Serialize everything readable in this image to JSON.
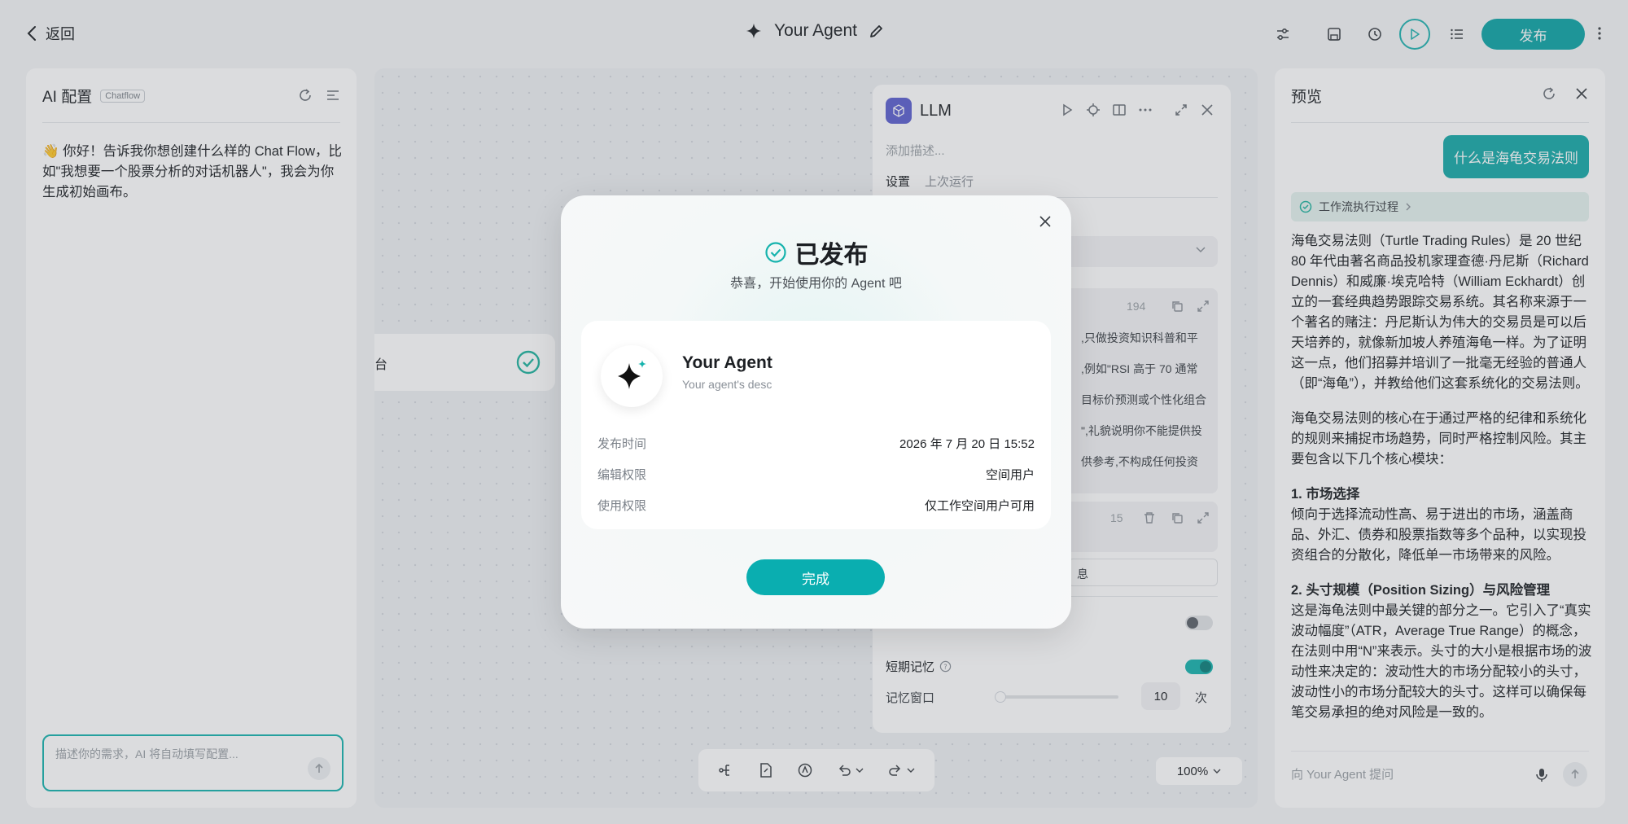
{
  "topbar": {
    "back_label": "返回",
    "agent_title": "Your Agent",
    "publish_label": "发布"
  },
  "left_panel": {
    "title": "AI 配置",
    "tag": "Chatflow",
    "message": "👋 你好！告诉我你想创建什么样的 Chat Flow，比如\"我想要一个股票分析的对话机器人\"，我会为你生成初始画布。",
    "input_placeholder": "描述你的需求，AI 将自动填写配置..."
  },
  "canvas": {
    "node_partial_label": "台",
    "llm": {
      "title": "LLM",
      "desc_placeholder": "添加描述...",
      "tab_settings": "设置",
      "tab_last_run": "上次运行",
      "token_count": "194",
      "prompt_lines": [
        ",只做投资知识科普和平",
        ",例如\"RSI 高于 70 通常",
        "目标价预测或个性化组合",
        "\",礼貌说明你不能提供投",
        "供参考,不构成任何投资"
      ],
      "count2": "15",
      "field_partial": "息",
      "memory_label": "短期记忆",
      "window_label": "记忆窗口",
      "window_value": "10",
      "window_unit": "次",
      "memory_on": true,
      "upper_toggle_on": false
    },
    "zoom": "100%"
  },
  "right_panel": {
    "title": "预览",
    "user_message": "什么是海龟交易法则",
    "flow_label": "工作流执行过程",
    "answer_p1": "海龟交易法则（Turtle Trading Rules）是 20 世纪 80 年代由著名商品投机家理查德·丹尼斯（Richard Dennis）和威廉·埃克哈特（William Eckhardt）创立的一套经典趋势跟踪交易系统。其名称来源于一个著名的赌注：丹尼斯认为伟大的交易员是可以后天培养的，就像新加坡人养殖海龟一样。为了证明这一点，他们招募并培训了一批毫无经验的普通人（即“海龟”），并教给他们这套系统化的交易法则。",
    "answer_p2": "海龟交易法则的核心在于通过严格的纪律和系统化的规则来捕捉市场趋势，同时严格控制风险。其主要包含以下几个核心模块：",
    "answer_h1": "1. 市场选择",
    "answer_p3": "倾向于选择流动性高、易于进出的市场，涵盖商品、外汇、债券和股票指数等多个品种，以实现投资组合的分散化，降低单一市场带来的风险。",
    "answer_h2": "2. 头寸规模（Position Sizing）与风险管理",
    "answer_p4": "这是海龟法则中最关键的部分之一。它引入了“真实波动幅度”（ATR，Average True Range）的概念，在法则中用“N”来表示。头寸的大小是根据市场的波动性来决定的：波动性大的市场分配较小的头寸，波动性小的市场分配较大的头寸。这样可以确保每笔交易承担的绝对风险是一致的。",
    "input_placeholder": "向 Your Agent 提问"
  },
  "modal": {
    "title": "已发布",
    "subtitle": "恭喜，开始使用你的 Agent 吧",
    "agent_name": "Your Agent",
    "agent_desc": "Your agent's desc",
    "rows": [
      {
        "key": "发布时间",
        "value": "2026 年 7 月 20 日 15:52"
      },
      {
        "key": "编辑权限",
        "value": "空间用户"
      },
      {
        "key": "使用权限",
        "value": "仅工作空间用户可用"
      }
    ],
    "done_label": "完成"
  },
  "colors": {
    "accent": "#0ea5a6",
    "llm_icon": "#5b5fcf"
  }
}
